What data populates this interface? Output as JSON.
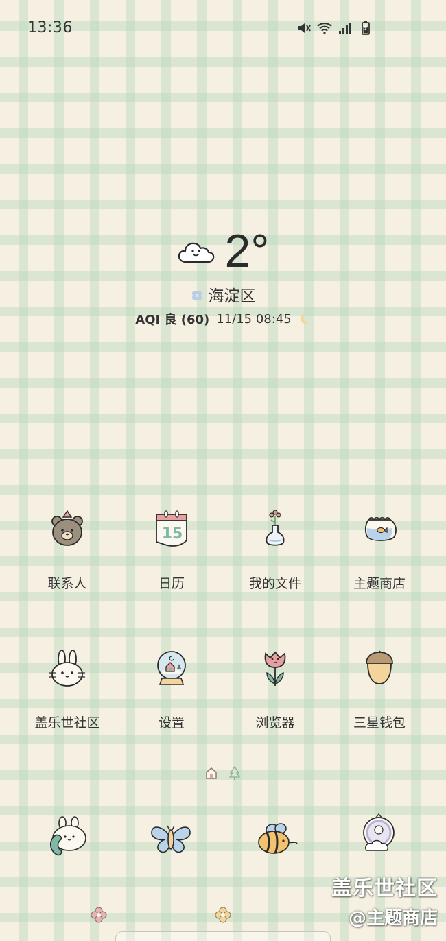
{
  "status_bar": {
    "time": "13:36",
    "icons": [
      "mute-icon",
      "wifi-icon",
      "signal-icon",
      "battery-charging-icon"
    ]
  },
  "weather": {
    "temperature": "2°",
    "location": "海淀区",
    "aqi": "AQI 良 (60)",
    "updated": "11/15 08:45",
    "condition_icon": "cloud-icon"
  },
  "apps": [
    {
      "label": "联系人",
      "icon": "bear-icon"
    },
    {
      "label": "日历",
      "icon": "calendar-icon",
      "day": "15"
    },
    {
      "label": "我的文件",
      "icon": "flower-vase-icon"
    },
    {
      "label": "主题商店",
      "icon": "fishbowl-icon"
    },
    {
      "label": "盖乐世社区",
      "icon": "bunny-icon"
    },
    {
      "label": "设置",
      "icon": "snow-globe-icon"
    },
    {
      "label": "浏览器",
      "icon": "tulip-icon"
    },
    {
      "label": "三星钱包",
      "icon": "acorn-icon"
    }
  ],
  "page_indicator": [
    "home-page-icon",
    "tree-page-icon"
  ],
  "dock": [
    {
      "icon": "bunny-phone-icon"
    },
    {
      "icon": "butterfly-icon"
    },
    {
      "icon": "bee-icon"
    },
    {
      "icon": "mirror-icon"
    }
  ],
  "watermark": {
    "line1": "盖乐世社区",
    "line2": "@主题商店"
  },
  "colors": {
    "background": "#f5f0e2",
    "grid": "#b9d7be",
    "calendar_red": "#e6a0a0",
    "calendar_green": "#7fb8a4"
  }
}
